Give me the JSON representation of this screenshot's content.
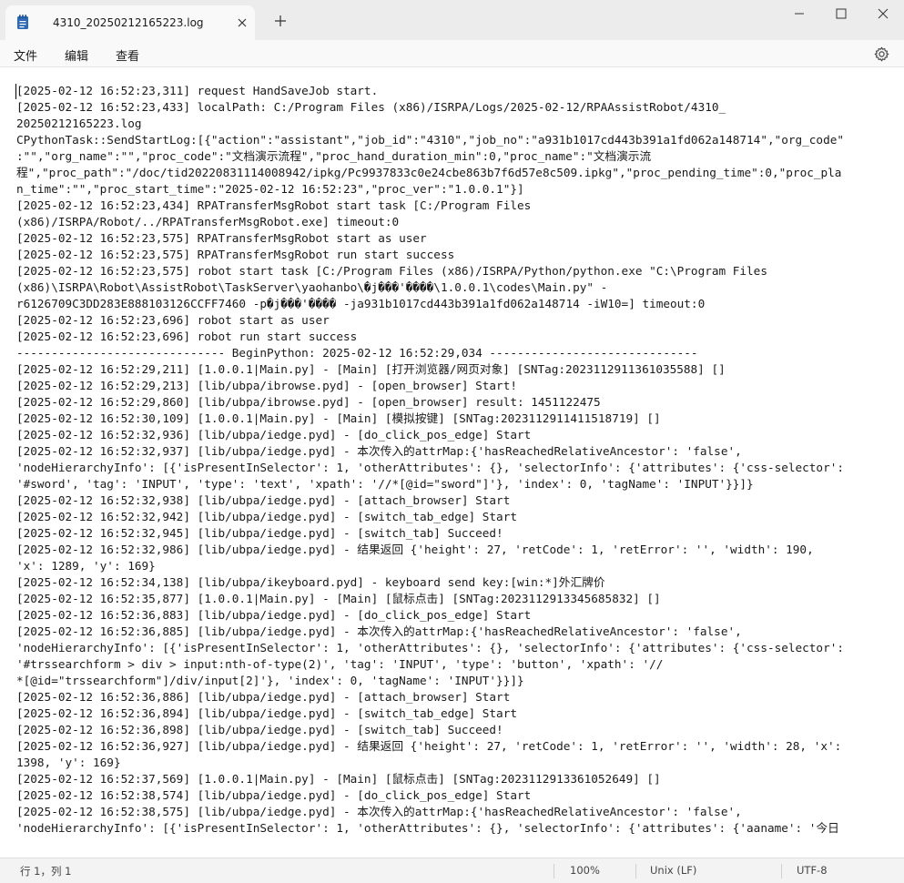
{
  "tab": {
    "title": "4310_20250212165223.log"
  },
  "menu": {
    "file": "文件",
    "edit": "编辑",
    "view": "查看"
  },
  "lines": [
    "[2025-02-12 16:52:23,311] request HandSaveJob start.",
    "[2025-02-12 16:52:23,433] localPath: C:/Program Files (x86)/ISRPA/Logs/2025-02-12/RPAAssistRobot/4310_",
    "20250212165223.log",
    "CPythonTask::SendStartLog:[{\"action\":\"assistant\",\"job_id\":\"4310\",\"job_no\":\"a931b1017cd443b391a1fd062a148714\",\"org_code\"",
    ":\"\",\"org_name\":\"\",\"proc_code\":\"文档演示流程\",\"proc_hand_duration_min\":0,\"proc_name\":\"文档演示流",
    "程\",\"proc_path\":\"/doc/tid20220831114008942/ipkg/Pc9937833c0e24cbe863b7f6d57e8c509.ipkg\",\"proc_pending_time\":0,\"proc_pla",
    "n_time\":\"\",\"proc_start_time\":\"2025-02-12 16:52:23\",\"proc_ver\":\"1.0.0.1\"}]",
    "[2025-02-12 16:52:23,434] RPATransferMsgRobot start task [C:/Program Files",
    "(x86)/ISRPA/Robot/../RPATransferMsgRobot.exe] timeout:0",
    "[2025-02-12 16:52:23,575] RPATransferMsgRobot start as user",
    "[2025-02-12 16:52:23,575] RPATransferMsgRobot run start success",
    "[2025-02-12 16:52:23,575] robot start task [C:/Program Files (x86)/ISRPA/Python/python.exe \"C:\\Program Files",
    "(x86)\\ISRPA\\Robot\\AssistRobot\\TaskServer\\yaohanbo\\�j���'����\\1.0.0.1\\codes\\Main.py\" -",
    "r6126709C3DD283E888103126CCFF7460 -p�j���'���� -ja931b1017cd443b391a1fd062a148714 -iW10=] timeout:0",
    "[2025-02-12 16:52:23,696] robot start as user",
    "[2025-02-12 16:52:23,696] robot run start success",
    "------------------------------ BeginPython: 2025-02-12 16:52:29,034 ------------------------------",
    "[2025-02-12 16:52:29,211] [1.0.0.1|Main.py] - [Main] [打开浏览器/网页对象] [SNTag:2023112911361035588] []",
    "[2025-02-12 16:52:29,213] [lib/ubpa/ibrowse.pyd] - [open_browser] Start!",
    "[2025-02-12 16:52:29,860] [lib/ubpa/ibrowse.pyd] - [open_browser] result: 1451122475",
    "[2025-02-12 16:52:30,109] [1.0.0.1|Main.py] - [Main] [模拟按键] [SNTag:2023112911411518719] []",
    "[2025-02-12 16:52:32,936] [lib/ubpa/iedge.pyd] - [do_click_pos_edge] Start",
    "[2025-02-12 16:52:32,937] [lib/ubpa/iedge.pyd] - 本次传入的attrMap:{'hasReachedRelativeAncestor': 'false',",
    "'nodeHierarchyInfo': [{'isPresentInSelector': 1, 'otherAttributes': {}, 'selectorInfo': {'attributes': {'css-selector':",
    "'#sword', 'tag': 'INPUT', 'type': 'text', 'xpath': '//*[@id=\"sword\"]'}, 'index': 0, 'tagName': 'INPUT'}}]}",
    "[2025-02-12 16:52:32,938] [lib/ubpa/iedge.pyd] - [attach_browser] Start",
    "[2025-02-12 16:52:32,942] [lib/ubpa/iedge.pyd] - [switch_tab_edge] Start",
    "[2025-02-12 16:52:32,945] [lib/ubpa/iedge.pyd] - [switch_tab] Succeed!",
    "[2025-02-12 16:52:32,986] [lib/ubpa/iedge.pyd] - 结果返回 {'height': 27, 'retCode': 1, 'retError': '', 'width': 190,",
    "'x': 1289, 'y': 169}",
    "[2025-02-12 16:52:34,138] [lib/ubpa/ikeyboard.pyd] - keyboard send key:[win:*]外汇牌价",
    "[2025-02-12 16:52:35,877] [1.0.0.1|Main.py] - [Main] [鼠标点击] [SNTag:2023112913345685832] []",
    "[2025-02-12 16:52:36,883] [lib/ubpa/iedge.pyd] - [do_click_pos_edge] Start",
    "[2025-02-12 16:52:36,885] [lib/ubpa/iedge.pyd] - 本次传入的attrMap:{'hasReachedRelativeAncestor': 'false',",
    "'nodeHierarchyInfo': [{'isPresentInSelector': 1, 'otherAttributes': {}, 'selectorInfo': {'attributes': {'css-selector':",
    "'#trssearchform > div > input:nth-of-type(2)', 'tag': 'INPUT', 'type': 'button', 'xpath': '//",
    "*[@id=\"trssearchform\"]/div/input[2]'}, 'index': 0, 'tagName': 'INPUT'}}]}",
    "[2025-02-12 16:52:36,886] [lib/ubpa/iedge.pyd] - [attach_browser] Start",
    "[2025-02-12 16:52:36,894] [lib/ubpa/iedge.pyd] - [switch_tab_edge] Start",
    "[2025-02-12 16:52:36,898] [lib/ubpa/iedge.pyd] - [switch_tab] Succeed!",
    "[2025-02-12 16:52:36,927] [lib/ubpa/iedge.pyd] - 结果返回 {'height': 27, 'retCode': 1, 'retError': '', 'width': 28, 'x':",
    "1398, 'y': 169}",
    "[2025-02-12 16:52:37,569] [1.0.0.1|Main.py] - [Main] [鼠标点击] [SNTag:2023112913361052649] []",
    "[2025-02-12 16:52:38,574] [lib/ubpa/iedge.pyd] - [do_click_pos_edge] Start",
    "[2025-02-12 16:52:38,575] [lib/ubpa/iedge.pyd] - 本次传入的attrMap:{'hasReachedRelativeAncestor': 'false',",
    "'nodeHierarchyInfo': [{'isPresentInSelector': 1, 'otherAttributes': {}, 'selectorInfo': {'attributes': {'aaname': '今日"
  ],
  "status": {
    "position": "行 1，列 1",
    "zoom": "100%",
    "line_ending": "Unix (LF)",
    "encoding": "UTF-8"
  },
  "icons": {
    "app": "notepad-icon",
    "close_tab": "close-icon",
    "new_tab": "plus-icon",
    "minimize": "minimize-icon",
    "maximize": "maximize-icon",
    "close_window": "close-icon",
    "settings": "gear-icon"
  },
  "colors": {
    "titlebar": "#ececec",
    "tab": "#f9f9f9",
    "app_icon": "#2b6bb5",
    "statusbar": "#f3f3f3"
  }
}
